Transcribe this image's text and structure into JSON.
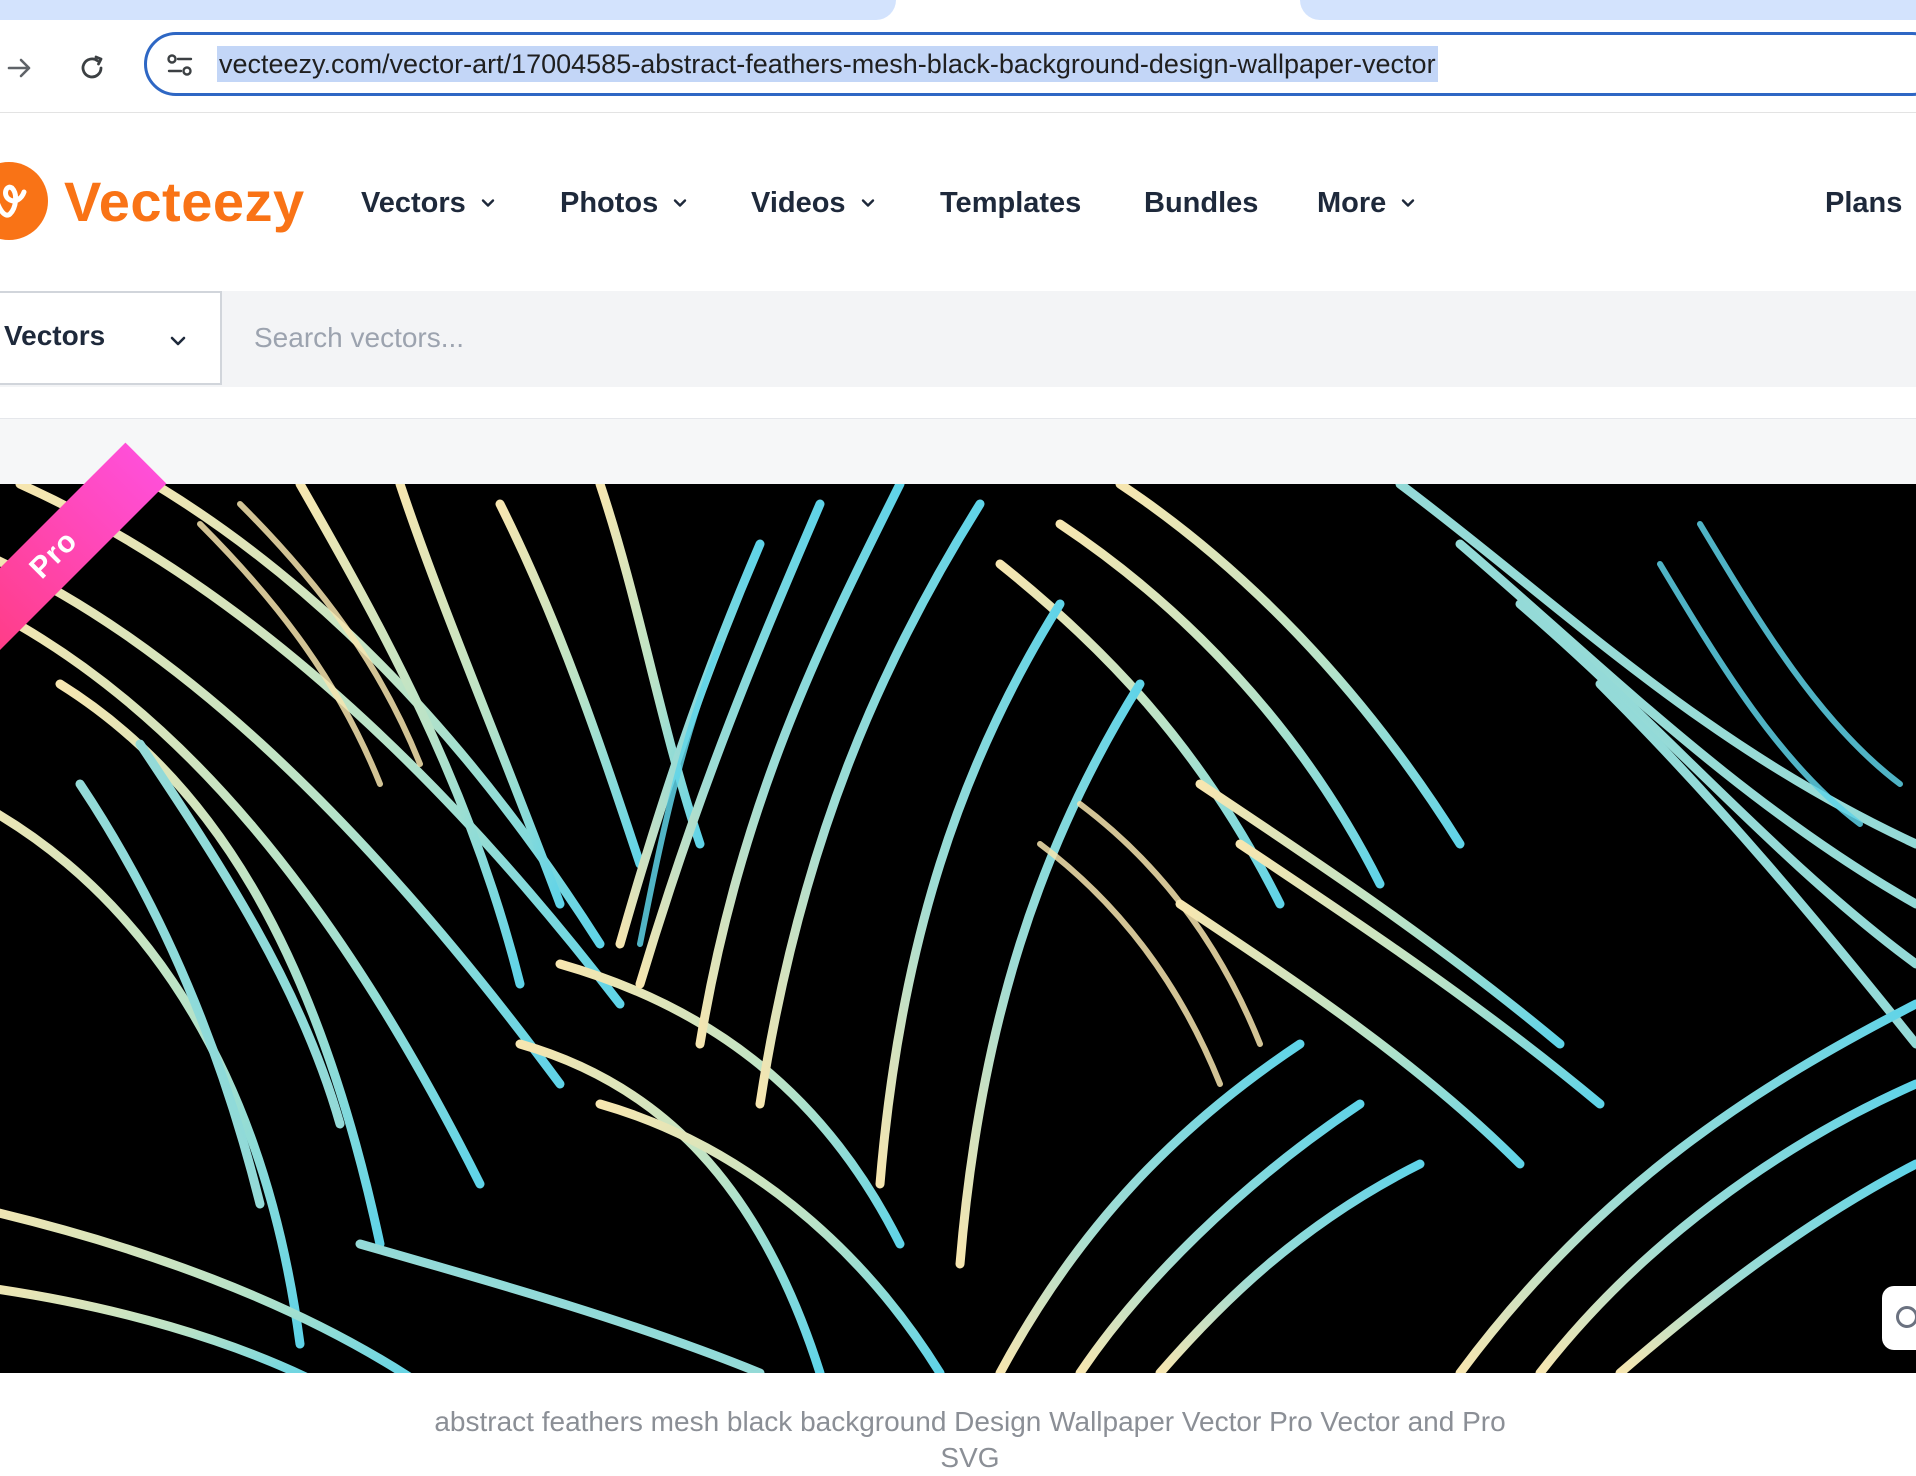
{
  "browser": {
    "url": "vecteezy.com/vector-art/17004585-abstract-feathers-mesh-black-background-design-wallpaper-vector"
  },
  "site": {
    "brand": "Vecteezy",
    "brand_color": "#f97316",
    "nav": [
      {
        "label": "Vectors",
        "has_dropdown": true
      },
      {
        "label": "Photos",
        "has_dropdown": true
      },
      {
        "label": "Videos",
        "has_dropdown": true
      },
      {
        "label": "Templates",
        "has_dropdown": false
      },
      {
        "label": "Bundles",
        "has_dropdown": false
      },
      {
        "label": "More",
        "has_dropdown": true
      },
      {
        "label": "Plans",
        "has_dropdown": false
      }
    ]
  },
  "search": {
    "type_label": "Vectors",
    "placeholder": "Search vectors..."
  },
  "preview": {
    "badge": "Pro",
    "badge_colors": [
      "#ff3b7f",
      "#ff4fd8"
    ],
    "palette": [
      "#000000",
      "#f7e6b0",
      "#5fd3e8"
    ],
    "caption": "abstract feathers mesh black background Design Wallpaper Vector Pro Vector and Pro SVG"
  }
}
